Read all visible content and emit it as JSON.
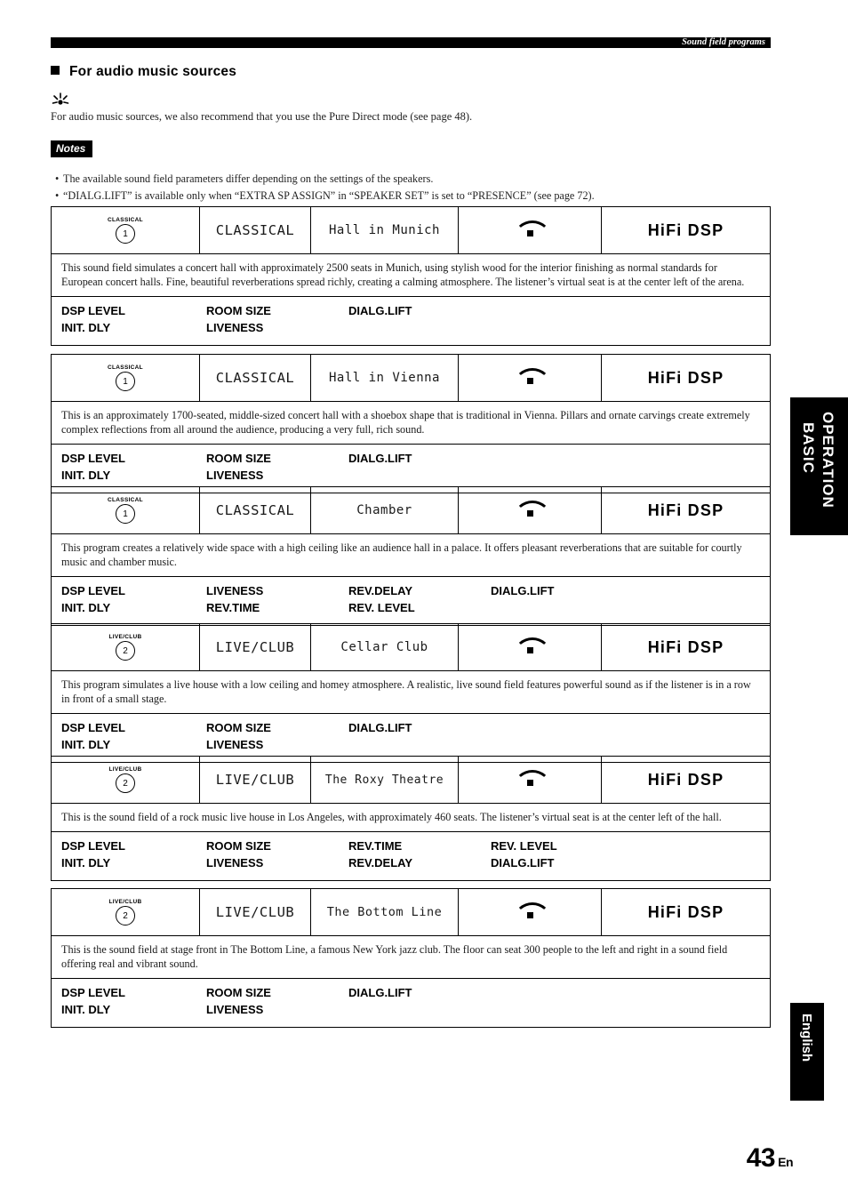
{
  "header": {
    "tab_label": "Sound field programs"
  },
  "section": {
    "title": "For audio music sources",
    "bullet_icon": "square-bullet"
  },
  "tip": {
    "icon": "tip-sparkle-icon",
    "text": "For audio music sources, we also recommend that you use the Pure Direct mode (see page 48)."
  },
  "notes": {
    "badge": "Notes",
    "items": [
      "The available sound field parameters differ depending on the settings of the speakers.",
      "“DIALG.LIFT” is available only when “EXTRA SP ASSIGN” in “SPEAKER SET” is set to “PRESENCE” (see page 72)."
    ]
  },
  "dsp_badge": "HiFi DSP",
  "speaker_icon": "presence-speaker-icon",
  "programs": [
    {
      "button_label": "CLASSICAL",
      "button_number": "1",
      "category": "CLASSICAL",
      "name": "Hall in Munich",
      "description": "This sound field simulates a concert hall with approximately 2500 seats in Munich, using stylish wood for the interior finishing as normal standards for European concert halls. Fine, beautiful reverberations spread richly, creating a calming atmosphere. The listener’s virtual seat is at the center left of the arena.",
      "params_row1": [
        "DSP LEVEL",
        "ROOM SIZE",
        "DIALG.LIFT"
      ],
      "params_row2": [
        "INIT. DLY",
        "LIVENESS",
        ""
      ]
    },
    {
      "button_label": "CLASSICAL",
      "button_number": "1",
      "category": "CLASSICAL",
      "name": "Hall in Vienna",
      "description": "This is an approximately 1700-seated, middle-sized concert hall with a shoebox shape that is traditional in Vienna. Pillars and ornate carvings create extremely complex reflections from all around the audience, producing a very full, rich sound.",
      "params_row1": [
        "DSP LEVEL",
        "ROOM SIZE",
        "DIALG.LIFT"
      ],
      "params_row2": [
        "INIT. DLY",
        "LIVENESS",
        ""
      ]
    },
    {
      "button_label": "CLASSICAL",
      "button_number": "1",
      "category": "CLASSICAL",
      "name": "Chamber",
      "description": "This program creates a relatively wide space with a high ceiling like an audience hall in a palace. It offers pleasant reverberations that are suitable for courtly music and chamber music.",
      "params_row1": [
        "DSP LEVEL",
        "LIVENESS",
        "REV.DELAY",
        "DIALG.LIFT"
      ],
      "params_row2": [
        "INIT. DLY",
        "REV.TIME",
        "REV. LEVEL",
        ""
      ]
    },
    {
      "button_label": "LIVE/CLUB",
      "button_number": "2",
      "category": "LIVE/CLUB",
      "name": "Cellar Club",
      "description": "This program simulates a live house with a low ceiling and homey atmosphere. A realistic, live sound field features powerful sound as if the listener is in a row in front of a small stage.",
      "params_row1": [
        "DSP LEVEL",
        "ROOM SIZE",
        "DIALG.LIFT"
      ],
      "params_row2": [
        "INIT. DLY",
        "LIVENESS",
        ""
      ]
    },
    {
      "button_label": "LIVE/CLUB",
      "button_number": "2",
      "category": "LIVE/CLUB",
      "name": "The Roxy Theatre",
      "description": "This is the sound field of a rock music live house in Los Angeles, with approximately 460 seats. The listener’s virtual seat is at the center left of the hall.",
      "params_row1": [
        "DSP LEVEL",
        "ROOM SIZE",
        "REV.TIME",
        "REV. LEVEL"
      ],
      "params_row2": [
        "INIT. DLY",
        "LIVENESS",
        "REV.DELAY",
        "DIALG.LIFT"
      ]
    },
    {
      "button_label": "LIVE/CLUB",
      "button_number": "2",
      "category": "LIVE/CLUB",
      "name": "The Bottom Line",
      "description": "This is the sound field at stage front in The Bottom Line, a famous New York jazz club. The floor can seat 300 people to the left and right in a sound field offering real and vibrant sound.",
      "params_row1": [
        "DSP LEVEL",
        "ROOM SIZE",
        "DIALG.LIFT"
      ],
      "params_row2": [
        "INIT. DLY",
        "LIVENESS",
        ""
      ]
    }
  ],
  "side_tabs": {
    "basic_line1": "BASIC",
    "basic_line2": "OPERATION",
    "language": "English"
  },
  "footer": {
    "page_number": "43",
    "page_suffix": "En"
  }
}
